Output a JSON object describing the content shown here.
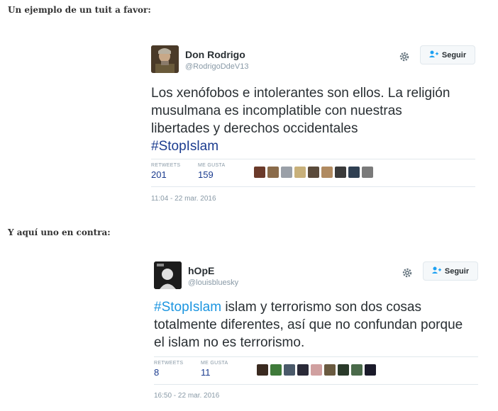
{
  "captions": {
    "first": "Un ejemplo de un tuit a favor:",
    "second": "Y aquí uno en contra:"
  },
  "tweet1": {
    "name": "Don Rodrigo",
    "handle": "@RodrigoDdeV13",
    "follow_label": "Seguir",
    "text_main": "Los xenófobos e intolerantes son ellos. La religión musulmana es incomplatible con nuestras libertades y derechos occidentales",
    "hashtag": "#StopIslam",
    "retweets_label": "RETWEETS",
    "retweets": "201",
    "likes_label": "ME GUSTA",
    "likes": "159",
    "timestamp": "11:04 - 22 mar. 2016",
    "liker_colors": [
      "#6b3a2a",
      "#8a6b4a",
      "#9aa0a8",
      "#c8b07a",
      "#5a4a3a",
      "#b08a60",
      "#3a3a3a",
      "#2f3f52",
      "#7a7a7a"
    ]
  },
  "tweet2": {
    "name": "hOpE",
    "handle": "@louisbluesky",
    "follow_label": "Seguir",
    "hashtag": "#StopIslam",
    "text_main": " islam y terrorismo son dos cosas totalmente diferentes, así que no confundan porque el islam no es terrorismo.",
    "retweets_label": "RETWEETS",
    "retweets": "8",
    "likes_label": "ME GUSTA",
    "likes": "11",
    "timestamp": "16:50 - 22 mar. 2016",
    "liker_colors": [
      "#3a2a20",
      "#3f7a3a",
      "#4a5a6a",
      "#2a2a38",
      "#d0a0a0",
      "#6a5a40",
      "#2a3a2a",
      "#4a6a4a",
      "#1a1a2a"
    ]
  },
  "icons": {
    "gear": "gear-icon",
    "follow": "person-plus-icon"
  }
}
